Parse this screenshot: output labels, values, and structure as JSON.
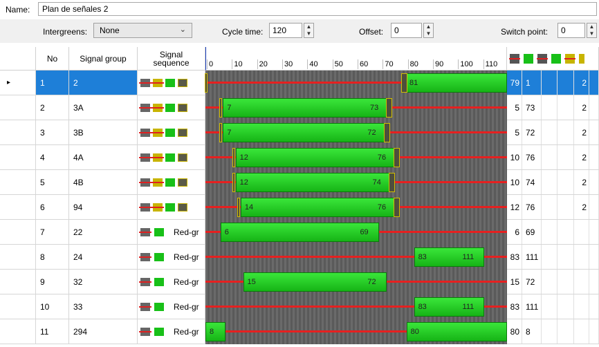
{
  "header": {
    "name_label": "Name:",
    "name_value": "Plan de señales 2"
  },
  "options": {
    "intergreens_label": "Intergreens:",
    "intergreens_value": "None",
    "cycle_label": "Cycle time:",
    "cycle_value": "120",
    "offset_label": "Offset:",
    "offset_value": "0",
    "switch_label": "Switch point:",
    "switch_value": "0"
  },
  "columns": {
    "no": "No",
    "group": "Signal group",
    "sequence": "Signal sequence",
    "ticks": [
      "0",
      "10",
      "20",
      "30",
      "40",
      "50",
      "60",
      "70",
      "80",
      "90",
      "100",
      "110"
    ]
  },
  "rows": [
    {
      "no": "1",
      "group": "2",
      "seq": "full",
      "start": "79",
      "end": "1",
      "extra": "2",
      "bar_start": 1,
      "bar_end": 79,
      "label_end": "81",
      "label_start": "",
      "wrap": true,
      "selected": true
    },
    {
      "no": "2",
      "group": "3A",
      "seq": "full",
      "start": "5",
      "end": "73",
      "extra": "2",
      "bar_start": 7,
      "bar_end": 73,
      "label_start": "7",
      "label_end": "73"
    },
    {
      "no": "3",
      "group": "3B",
      "seq": "full",
      "start": "5",
      "end": "72",
      "extra": "2",
      "bar_start": 7,
      "bar_end": 72,
      "label_start": "7",
      "label_end": "72"
    },
    {
      "no": "4",
      "group": "4A",
      "seq": "full",
      "start": "10",
      "end": "76",
      "extra": "2",
      "bar_start": 12,
      "bar_end": 76,
      "label_start": "12",
      "label_end": "76"
    },
    {
      "no": "5",
      "group": "4B",
      "seq": "full",
      "start": "10",
      "end": "74",
      "extra": "2",
      "bar_start": 12,
      "bar_end": 74,
      "label_start": "12",
      "label_end": "74"
    },
    {
      "no": "6",
      "group": "94",
      "seq": "full",
      "start": "12",
      "end": "76",
      "extra": "2",
      "bar_start": 14,
      "bar_end": 76,
      "label_start": "14",
      "label_end": "76"
    },
    {
      "no": "7",
      "group": "22",
      "seq": "redgr",
      "seq_label": "Red-gr",
      "start": "6",
      "end": "69",
      "extra": "",
      "bar_start": 6,
      "bar_end": 69,
      "label_start": "6",
      "label_end": "69"
    },
    {
      "no": "8",
      "group": "24",
      "seq": "redgr",
      "seq_label": "Red-gr",
      "start": "83",
      "end": "111",
      "extra": "",
      "bar_start": 83,
      "bar_end": 111,
      "label_start": "83",
      "label_end": "111"
    },
    {
      "no": "9",
      "group": "32",
      "seq": "redgr",
      "seq_label": "Red-gr",
      "start": "15",
      "end": "72",
      "extra": "",
      "bar_start": 15,
      "bar_end": 72,
      "label_start": "15",
      "label_end": "72"
    },
    {
      "no": "10",
      "group": "33",
      "seq": "redgr",
      "seq_label": "Red-gr",
      "start": "83",
      "end": "111",
      "extra": "",
      "bar_start": 83,
      "bar_end": 111,
      "label_start": "83",
      "label_end": "111"
    },
    {
      "no": "11",
      "group": "294",
      "seq": "redgr",
      "seq_label": "Red-gr",
      "start": "80",
      "end": "8",
      "extra": "",
      "bar_start": 80,
      "bar_end": 8,
      "label_start": "80",
      "label_end": "8",
      "wrap": true
    }
  ]
}
